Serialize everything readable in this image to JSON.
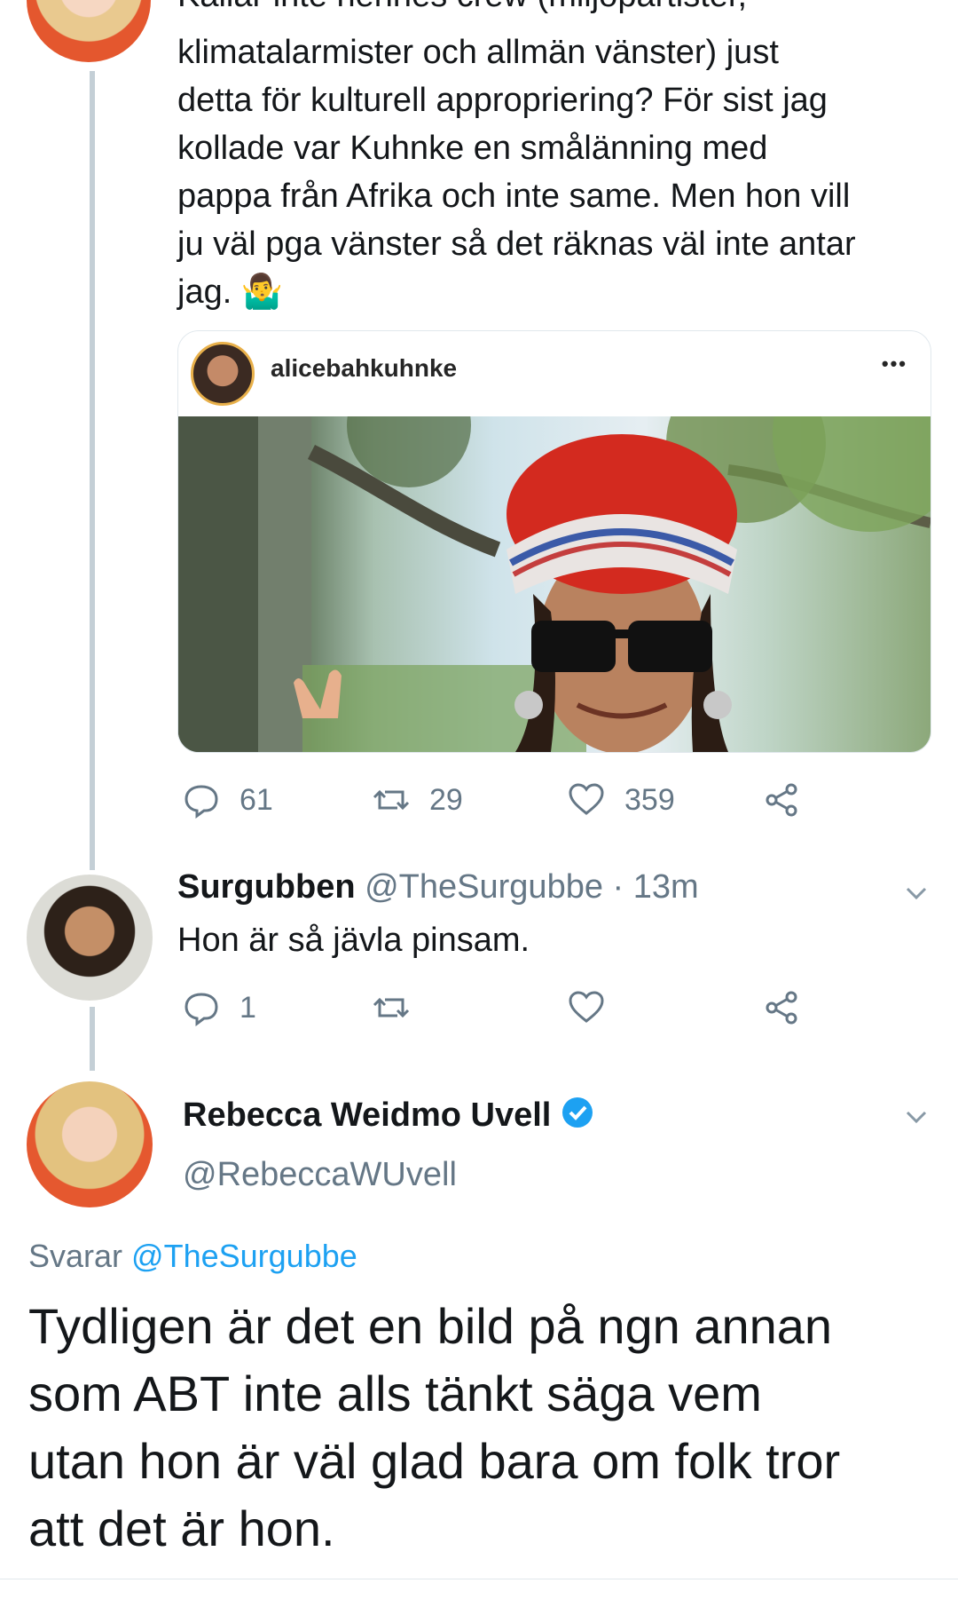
{
  "tweet1": {
    "text_top_partial": "Kallar inte hennes crew (miljöpartister,",
    "lines": [
      "klimatalarmister och allmän vänster) just",
      "detta för kulturell appropriering? För sist jag",
      "kollade var Kuhnke en smålänning med",
      "pappa från Afrika och inte same. Men hon vill",
      "ju väl pga vänster så det räknas väl inte antar",
      "jag."
    ],
    "emoji": "🤷‍♂️",
    "embed": {
      "username": "alicebahkuhnke",
      "more": "•••"
    },
    "actions": {
      "replies": "61",
      "retweets": "29",
      "likes": "359"
    }
  },
  "tweet2": {
    "name": "Surgubben",
    "handle": "@TheSurgubbe",
    "separator": "·",
    "time": "13m",
    "text": "Hon är så jävla pinsam.",
    "actions": {
      "replies": "1"
    }
  },
  "tweet3": {
    "name": "Rebecca Weidmo Uvell",
    "handle": "@RebeccaWUvell",
    "replying_prefix": "Svarar",
    "replying_to": "@TheSurgubbe",
    "lines": [
      "Tydligen är det en bild på ngn annan",
      "som ABT inte alls tänkt säga vem",
      "utan hon är väl glad bara om folk tror",
      "att det är hon."
    ]
  },
  "colors": {
    "link": "#1da1f2",
    "muted": "#657786",
    "verified": "#1da1f2"
  }
}
